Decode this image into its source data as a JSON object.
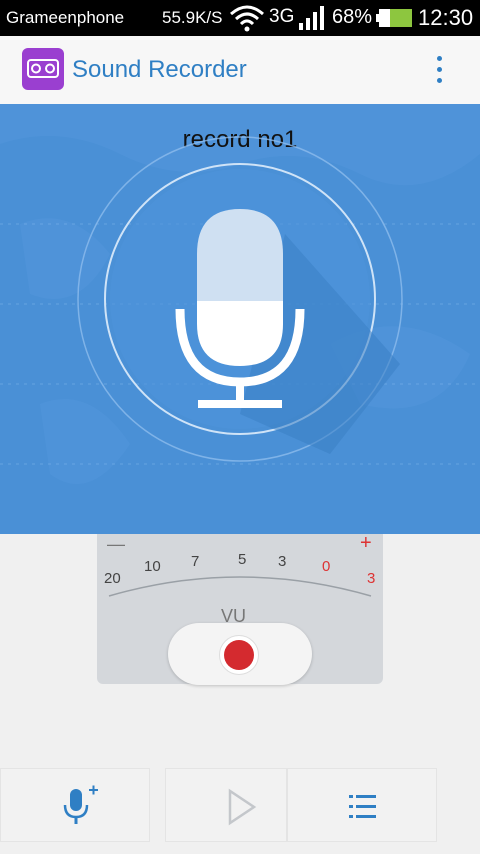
{
  "status_bar": {
    "carrier": "Grameenphone",
    "speed": "55.9K/S",
    "network": "3G",
    "battery": "68%",
    "time": "12:30"
  },
  "app_bar": {
    "title": "Sound Recorder",
    "icon": "cassette-icon",
    "menu_icon": "more-vert-icon"
  },
  "hero": {
    "record_name": "record no1",
    "icon": "microphone-icon"
  },
  "meter": {
    "minus": "—",
    "plus": "+",
    "ticks": [
      "20",
      "10",
      "7",
      "5",
      "3",
      "0",
      "3"
    ],
    "label": "VU",
    "record_button_icon": "record-icon"
  },
  "bottom_bar": {
    "items": [
      {
        "icon": "add-mic-icon"
      },
      {
        "icon": "play-icon"
      },
      {
        "icon": "list-icon"
      }
    ]
  },
  "colors": {
    "accent": "#2f7fc4",
    "hero_bg": "#4a90d6",
    "record_red": "#d42a2f",
    "app_icon": "#9a3fd0"
  }
}
